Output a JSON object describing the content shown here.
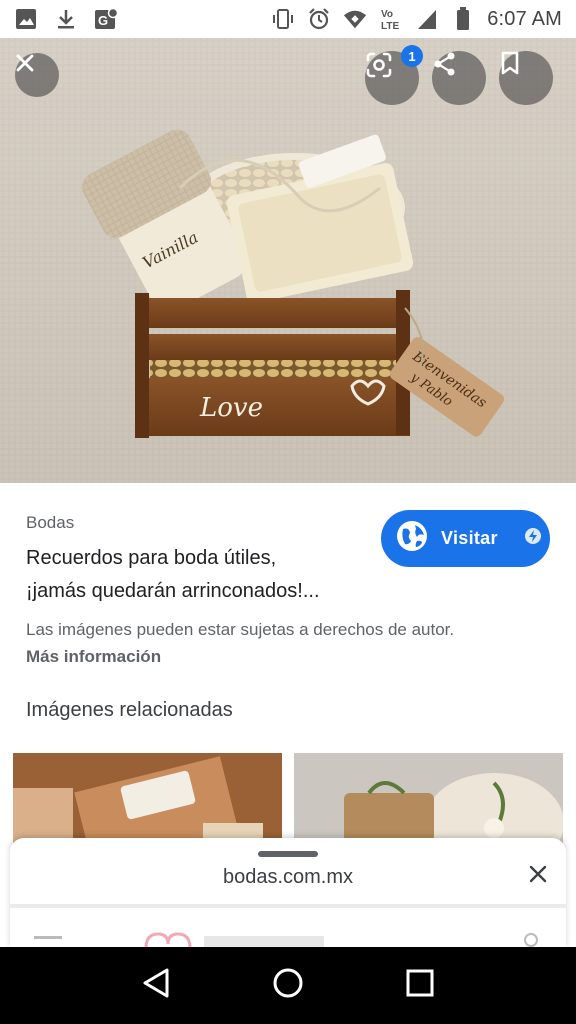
{
  "status_bar": {
    "left_icons": [
      "image-icon",
      "download-icon",
      "google-maps-icon"
    ],
    "right_icons": [
      "vibrate-icon",
      "alarm-icon",
      "wifi-icon",
      "volte-icon",
      "signal-icon",
      "battery-icon"
    ],
    "volte_text": "Vo LTE",
    "time": "6:07 AM"
  },
  "hero": {
    "close_icon": "close-icon",
    "lens_icon": "google-lens-icon",
    "lens_badge": "1",
    "share_icon": "share-icon",
    "bookmark_icon": "bookmark-icon",
    "image_alt": "Wooden crate with soaps and tags"
  },
  "result": {
    "source": "Bodas",
    "title_line1": "Recuerdos para boda útiles,",
    "title_line2": "¡jamás quedarán arrinconados!...",
    "visit_label": "Visitar",
    "copyright": "Las imágenes pueden estar sujetas a derechos de autor.",
    "more_info": "Más información",
    "related_heading": "Imágenes relacionadas"
  },
  "sheet": {
    "domain": "bodas.com.mx"
  },
  "navbar": {
    "back": "back-icon",
    "home": "home-icon",
    "recents": "recents-icon"
  },
  "colors": {
    "accent": "#1a73e8",
    "text_primary": "#202124",
    "text_secondary": "#5f6368"
  }
}
